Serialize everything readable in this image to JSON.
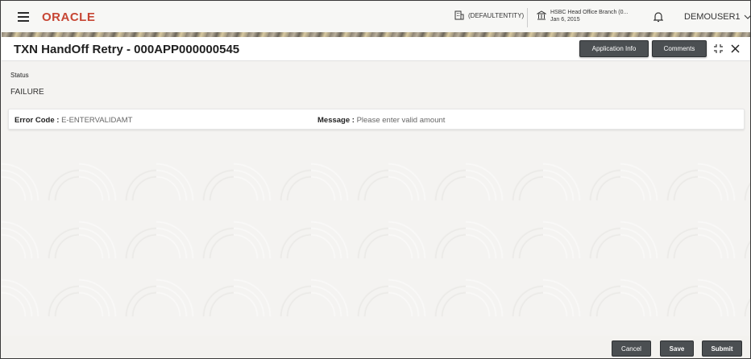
{
  "header": {
    "logo": "ORACLE",
    "entity": "(DEFAULTENTITY)",
    "branch_name": "HSBC Head Office Branch (0...",
    "branch_date": "Jan 6, 2015",
    "user": "DEMOUSER1"
  },
  "titlebar": {
    "title": "TXN HandOff Retry - 000APP000000545",
    "application_info": "Application Info",
    "comments": "Comments"
  },
  "status": {
    "label": "Status",
    "value": "FAILURE"
  },
  "error": {
    "code_label": "Error Code :",
    "code_value": "E-ENTERVALIDAMT",
    "message_label": "Message :",
    "message_value": "Please enter valid amount"
  },
  "footer": {
    "cancel": "Cancel",
    "save": "Save",
    "submit": "Submit"
  },
  "colors": {
    "brand": "#c74634",
    "button": "#4b4f52"
  }
}
